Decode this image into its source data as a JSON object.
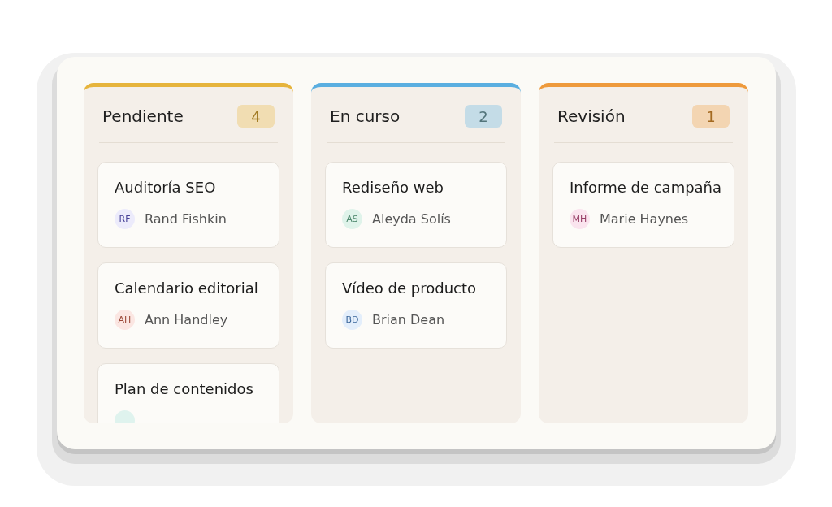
{
  "board": {
    "columns": [
      {
        "title": "Pendiente",
        "count": "4",
        "color": "#e6b43c",
        "cards": [
          {
            "title": "Auditoría SEO",
            "initials": "RF",
            "assignee": "Rand Fishkin",
            "color": "#ecebfb"
          },
          {
            "title": "Calendario editorial",
            "initials": "AH",
            "assignee": "Ann Handley",
            "color": "#fbe6e2"
          },
          {
            "title": "Plan de contenidos",
            "color": "#dff3ee"
          }
        ]
      },
      {
        "title": "En curso",
        "count": "2",
        "color": "#5aaee0",
        "cards": [
          {
            "title": "Rediseño web",
            "initials": "AS",
            "assignee": "Aleyda Solís",
            "color": "#dff3ea"
          },
          {
            "title": "Vídeo de producto",
            "initials": "BD",
            "assignee": "Brian Dean",
            "color": "#e3eefb"
          }
        ]
      },
      {
        "title": "Revisión",
        "count": "1",
        "color": "#ee9a3c",
        "cards": [
          {
            "title": "Informe de campaña",
            "initials": "MH",
            "assignee": "Marie Haynes",
            "color": "#fae4ee"
          }
        ]
      }
    ]
  }
}
